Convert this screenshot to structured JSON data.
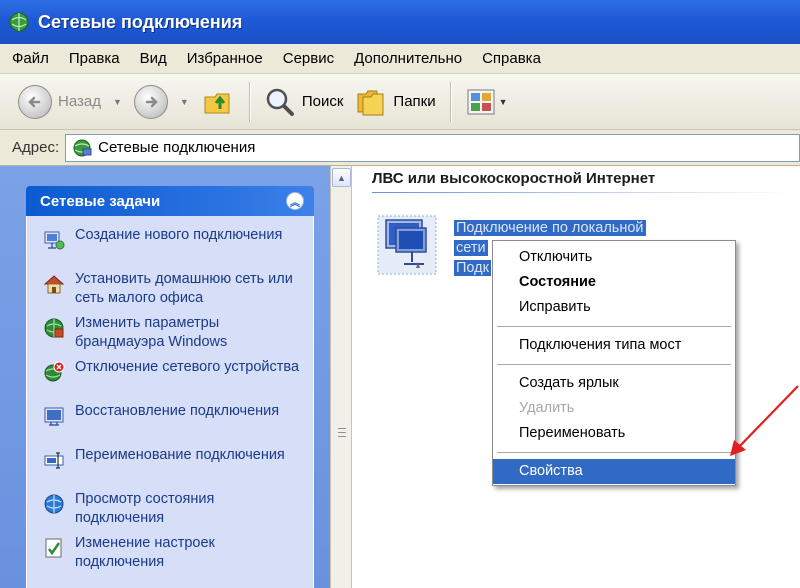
{
  "window": {
    "title": "Сетевые подключения"
  },
  "menu": {
    "items": [
      "Файл",
      "Правка",
      "Вид",
      "Избранное",
      "Сервис",
      "Дополнительно",
      "Справка"
    ]
  },
  "toolbar": {
    "back_label": "Назад",
    "search_label": "Поиск",
    "folders_label": "Папки"
  },
  "address": {
    "label": "Адрес:",
    "value": "Сетевые подключения"
  },
  "tasks": {
    "title": "Сетевые задачи",
    "items": [
      {
        "label": "Создание нового подключения",
        "icon": "new-connection-icon"
      },
      {
        "label": "Установить домашнюю сеть или сеть малого офиса",
        "icon": "home-network-icon"
      },
      {
        "label": "Изменить параметры брандмауэра Windows",
        "icon": "firewall-icon"
      },
      {
        "label": "Отключение сетевого устройства",
        "icon": "disable-device-icon"
      },
      {
        "label": "Восстановление подключения",
        "icon": "repair-icon"
      },
      {
        "label": "Переименование подключения",
        "icon": "rename-icon"
      },
      {
        "label": "Просмотр состояния подключения",
        "icon": "status-icon"
      },
      {
        "label": "Изменение настроек подключения",
        "icon": "settings-icon"
      }
    ]
  },
  "content": {
    "group_header": "ЛВС или высокоскоростной Интернет",
    "connection": {
      "line1": "Подключение по локальной",
      "line2": "сети",
      "line3": "Подк"
    }
  },
  "context_menu": {
    "items": [
      {
        "label": "Отключить",
        "state": "normal"
      },
      {
        "label": "Состояние",
        "state": "bold"
      },
      {
        "label": "Исправить",
        "state": "normal"
      },
      {
        "label": "Подключения типа мост",
        "state": "normal"
      },
      {
        "label": "Создать ярлык",
        "state": "normal"
      },
      {
        "label": "Удалить",
        "state": "disabled"
      },
      {
        "label": "Переименовать",
        "state": "normal"
      },
      {
        "label": "Свойства",
        "state": "selected"
      }
    ]
  },
  "colors": {
    "titlebar": "#1e5ad6",
    "selection": "#316ac5",
    "task_pane": "#6a91de",
    "arrow": "#e02020"
  }
}
